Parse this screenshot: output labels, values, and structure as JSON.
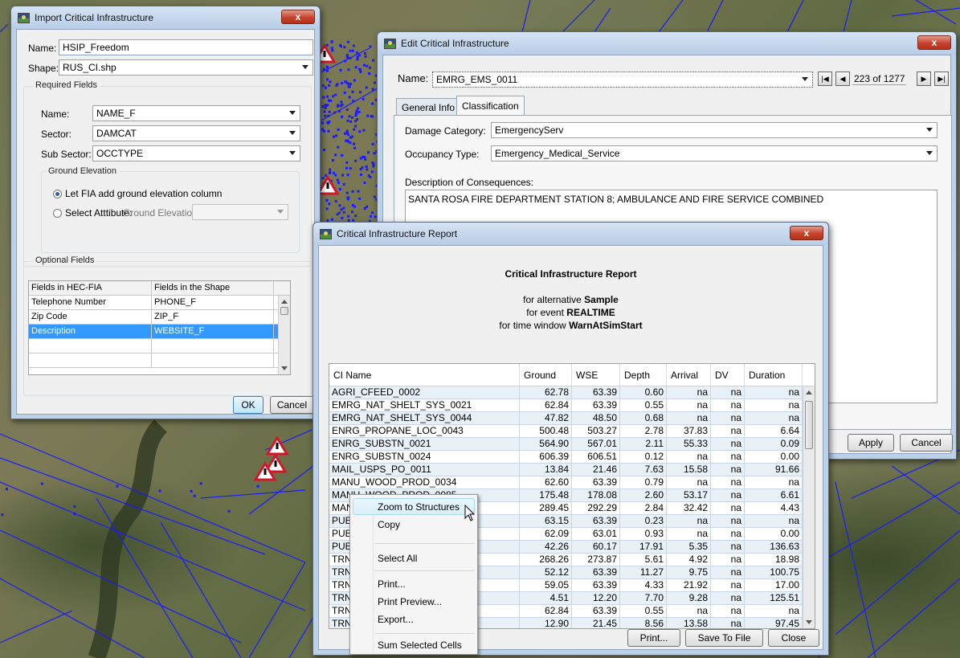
{
  "import_dialog": {
    "title": "Import Critical Infrastructure",
    "close_label": "x",
    "name_label": "Name:",
    "name_value": "HSIP_Freedom",
    "shape_label": "Shape:",
    "shape_value": "RUS_CI.shp",
    "required_fields_label": "Required Fields",
    "req_name_label": "Name:",
    "req_name_value": "NAME_F",
    "sector_label": "Sector:",
    "sector_value": "DAMCAT",
    "subsector_label": "Sub Sector:",
    "subsector_value": "OCCTYPE",
    "ground_elev_label": "Ground Elevation",
    "radio_fia_label": "Let FIA add ground elevation column",
    "radio_select_label": "Select Atttibute:",
    "ground_elev_field_label": "Ground Elevation:",
    "optional_fields_label": "Optional Fields",
    "table_headers": [
      "Fields in HEC-FIA",
      "Fields in the Shape"
    ],
    "table_rows": [
      [
        "Telephone Number",
        "PHONE_F"
      ],
      [
        "Zip Code",
        "ZIP_F"
      ],
      [
        "Description",
        "WEBSITE_F"
      ],
      [
        "",
        ""
      ],
      [
        "",
        ""
      ]
    ],
    "ok_label": "OK",
    "cancel_label": "Cancel"
  },
  "edit_dialog": {
    "title": "Edit Critical Infrastructure",
    "close_label": "x",
    "name_label": "Name:",
    "name_value": "EMRG_EMS_0011",
    "record_position": "223 of 1277",
    "nav_first": "|◀",
    "nav_prev": "◀",
    "nav_next": "▶",
    "nav_last": "▶|",
    "tabs": [
      "General Info",
      "Classification"
    ],
    "damage_category_label": "Damage Category:",
    "damage_category_value": "EmergencyServ",
    "occupancy_type_label": "Occupancy Type:",
    "occupancy_type_value": "Emergency_Medical_Service",
    "description_label": "Description of Consequences:",
    "description_value": "SANTA ROSA FIRE DEPARTMENT STATION 8; AMBULANCE AND FIRE SERVICE COMBINED",
    "apply_label": "Apply",
    "cancel_label": "Cancel"
  },
  "report_dialog": {
    "title": "Critical Infrastructure Report",
    "close_label": "x",
    "report_title": "Critical Infrastructure Report",
    "alt_prefix": "for alternative ",
    "alt_value": "Sample",
    "event_prefix": "for event ",
    "event_value": "REALTIME",
    "window_prefix": "for time window ",
    "window_value": "WarnAtSimStart",
    "columns": [
      "CI Name",
      "Ground",
      "WSE",
      "Depth",
      "Arrival",
      "DV",
      "Duration"
    ],
    "rows": [
      [
        "AGRI_CFEED_0002",
        "62.78",
        "63.39",
        "0.60",
        "na",
        "na",
        "na"
      ],
      [
        "EMRG_NAT_SHELT_SYS_0021",
        "62.84",
        "63.39",
        "0.55",
        "na",
        "na",
        "na"
      ],
      [
        "EMRG_NAT_SHELT_SYS_0044",
        "47.82",
        "48.50",
        "0.68",
        "na",
        "na",
        "na"
      ],
      [
        "ENRG_PROPANE_LOC_0043",
        "500.48",
        "503.27",
        "2.78",
        "37.83",
        "na",
        "6.64"
      ],
      [
        "ENRG_SUBSTN_0021",
        "564.90",
        "567.01",
        "2.11",
        "55.33",
        "na",
        "0.09"
      ],
      [
        "ENRG_SUBSTN_0024",
        "606.39",
        "606.51",
        "0.12",
        "na",
        "na",
        "0.00"
      ],
      [
        "MAIL_USPS_PO_0011",
        "13.84",
        "21.46",
        "7.63",
        "15.58",
        "na",
        "91.66"
      ],
      [
        "MANU_WOOD_PROD_0034",
        "62.60",
        "63.39",
        "0.79",
        "na",
        "na",
        "na"
      ],
      [
        "MANU_WOOD_PROD_0085",
        "175.48",
        "178.08",
        "2.60",
        "53.17",
        "na",
        "6.61"
      ],
      [
        "MANU_WOOD_PROD_0092",
        "289.45",
        "292.29",
        "2.84",
        "32.42",
        "na",
        "4.43"
      ],
      [
        "PUB                                        K_0016",
        "63.15",
        "63.39",
        "0.23",
        "na",
        "na",
        "na"
      ],
      [
        "PUB                                        K_0042",
        "62.09",
        "63.01",
        "0.93",
        "na",
        "na",
        "0.00"
      ],
      [
        "PUB",
        "42.26",
        "60.17",
        "17.91",
        "5.35",
        "na",
        "136.63"
      ],
      [
        "TRN",
        "268.26",
        "273.87",
        "5.61",
        "4.92",
        "na",
        "18.98"
      ],
      [
        "TRN",
        "52.12",
        "63.39",
        "11.27",
        "9.75",
        "na",
        "100.75"
      ],
      [
        "TRN",
        "59.05",
        "63.39",
        "4.33",
        "21.92",
        "na",
        "17.00"
      ],
      [
        "TRN",
        "4.51",
        "12.20",
        "7.70",
        "9.28",
        "na",
        "125.51"
      ],
      [
        "TRN",
        "62.84",
        "63.39",
        "0.55",
        "na",
        "na",
        "na"
      ],
      [
        "TRN",
        "12.90",
        "21.45",
        "8.56",
        "13.58",
        "na",
        "97.45"
      ]
    ],
    "print_label": "Print...",
    "save_label": "Save To File",
    "close_button_label": "Close"
  },
  "context_menu": {
    "items": [
      "Zoom to Structures",
      "Copy",
      "Select All",
      "Print...",
      "Print Preview...",
      "Export...",
      "Sum Selected Cells"
    ]
  },
  "colors": {
    "selection": "#3399ff",
    "map_lines": "#1b1bff",
    "warning_red": "#d0182a"
  }
}
